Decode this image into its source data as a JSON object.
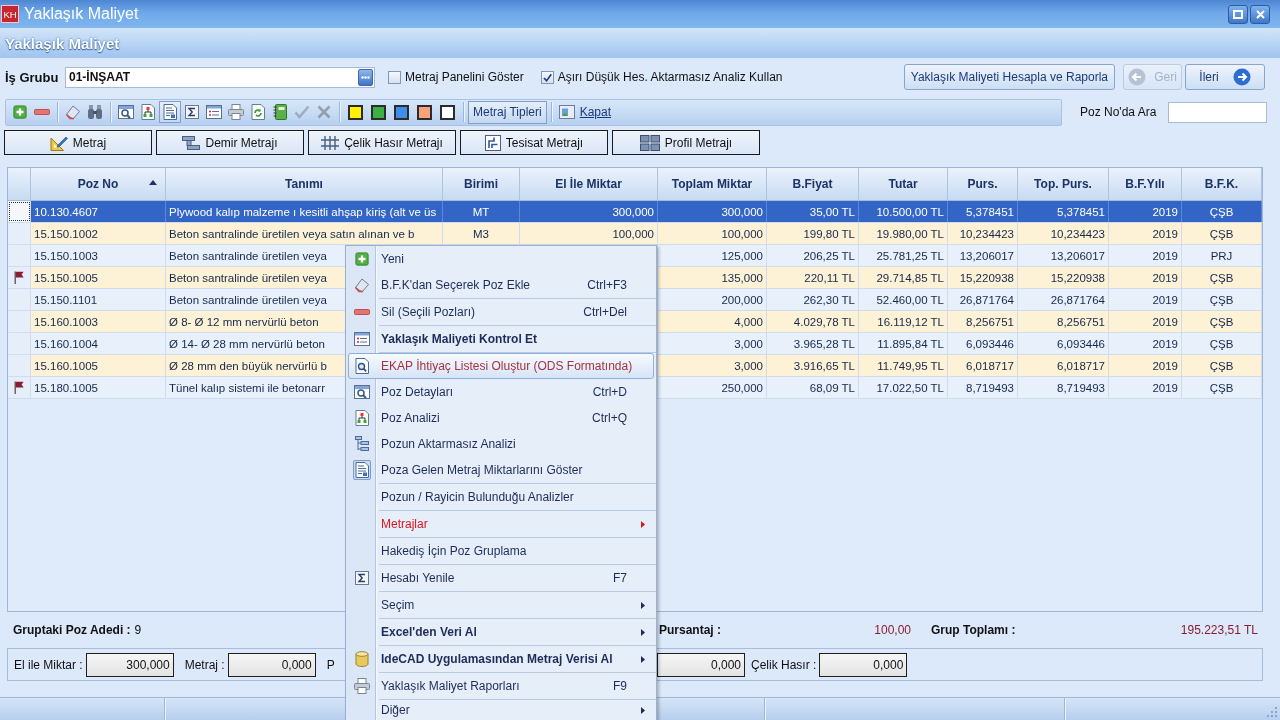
{
  "window": {
    "logo": "KH",
    "title": "Yaklaşık Maliyet"
  },
  "header": {
    "title": "Yaklaşık Maliyet"
  },
  "work_group": {
    "label": "İş Grubu",
    "value": "01-İNŞAAT"
  },
  "options": [
    {
      "label": "Metraj Panelini Göster",
      "checked": false
    },
    {
      "label": "Aşırı Düşük Hes. Aktarmasız Analiz Kullan",
      "checked": true
    }
  ],
  "actions": [
    {
      "kind": "plain",
      "label": "Yaklaşık Maliyeti Hesapla ve Raporla",
      "disabled": false
    },
    {
      "kind": "back",
      "label": "Geri",
      "disabled": true
    },
    {
      "kind": "forward",
      "label": "İleri",
      "disabled": false
    }
  ],
  "toolbar": [
    [
      {
        "kind": "icon",
        "pressed": false,
        "disabled": false
      },
      {
        "kind": "icon",
        "pressed": false,
        "disabled": false
      }
    ],
    [
      {
        "kind": "icon",
        "pressed": false,
        "disabled": false
      },
      {
        "kind": "icon",
        "pressed": false,
        "disabled": false
      }
    ],
    [
      {
        "kind": "icon",
        "pressed": false,
        "disabled": false
      },
      {
        "kind": "icon",
        "pressed": false,
        "disabled": false
      },
      {
        "kind": "icon",
        "pressed": true,
        "disabled": false
      },
      {
        "kind": "icon",
        "pressed": false,
        "disabled": false
      },
      {
        "kind": "icon",
        "pressed": false,
        "disabled": false
      },
      {
        "kind": "icon",
        "pressed": false,
        "disabled": false
      },
      {
        "kind": "icon",
        "pressed": false,
        "disabled": false
      },
      {
        "kind": "icon",
        "pressed": false,
        "disabled": false
      },
      {
        "kind": "icon",
        "pressed": false,
        "disabled": true
      },
      {
        "kind": "icon",
        "pressed": false,
        "disabled": true
      }
    ],
    [
      {
        "kind": "swatch",
        "color": "#fff200"
      },
      {
        "kind": "swatch",
        "color": "#3cb043"
      },
      {
        "kind": "swatch",
        "color": "#3d8ee8"
      },
      {
        "kind": "swatch",
        "color": "#f7a27a"
      },
      {
        "kind": "swatch",
        "color": "#ffffff"
      }
    ],
    [
      {
        "kind": "toggle",
        "label": "Metraj Tipleri",
        "pressed": true
      }
    ],
    [
      {
        "kind": "link",
        "label": "Kapat"
      }
    ]
  ],
  "search": {
    "label": "Poz No'da Ara"
  },
  "metraj_buttons": [
    "Metraj",
    "Demir Metrajı",
    "Çelik Hasır Metrajı",
    "Tesisat Metrajı",
    "Profil Metrajı"
  ],
  "table": {
    "columns": [
      {
        "label": "Poz No",
        "sorted": true
      },
      {
        "label": "Tanımı",
        "sorted": false
      },
      {
        "label": "Birimi",
        "sorted": false
      },
      {
        "label": "El İle Miktar",
        "sorted": false
      },
      {
        "label": "Toplam Miktar",
        "sorted": false
      },
      {
        "label": "B.Fiyat",
        "sorted": false
      },
      {
        "label": "Tutar",
        "sorted": false
      },
      {
        "label": "Purs.",
        "sorted": false
      },
      {
        "label": "Top. Purs.",
        "sorted": false
      },
      {
        "label": "B.F.Yılı",
        "sorted": false
      },
      {
        "label": "B.F.K.",
        "sorted": false
      }
    ],
    "rows": [
      {
        "flagged": false,
        "selected": true,
        "cells": [
          "10.130.4607",
          "Plywood kalıp malzeme ı kesitli ahşap kiriş (alt ve üs",
          "MT",
          "300,000",
          "300,000",
          "35,00 TL",
          "10.500,00 TL",
          "5,378451",
          "5,378451",
          "2019",
          "ÇŞB"
        ]
      },
      {
        "flagged": false,
        "selected": false,
        "cells": [
          "15.150.1002",
          "Beton santralinde üretilen veya satın alınan ve b",
          "M3",
          "100,000",
          "100,000",
          "199,80 TL",
          "19.980,00 TL",
          "10,234423",
          "10,234423",
          "2019",
          "ÇŞB"
        ]
      },
      {
        "flagged": false,
        "selected": false,
        "cells": [
          "15.150.1003",
          "Beton santralinde üretilen veya",
          null,
          null,
          "125,000",
          "206,25 TL",
          "25.781,25 TL",
          "13,206017",
          "13,206017",
          "2019",
          "PRJ"
        ]
      },
      {
        "flagged": true,
        "selected": false,
        "cells": [
          "15.150.1005",
          "Beton santralinde üretilen veya",
          null,
          null,
          "135,000",
          "220,11 TL",
          "29.714,85 TL",
          "15,220938",
          "15,220938",
          "2019",
          "ÇŞB"
        ]
      },
      {
        "flagged": false,
        "selected": false,
        "cells": [
          "15.150.1101",
          "Beton santralinde üretilen veya",
          null,
          null,
          "200,000",
          "262,30 TL",
          "52.460,00 TL",
          "26,871764",
          "26,871764",
          "2019",
          "ÇŞB"
        ]
      },
      {
        "flagged": false,
        "selected": false,
        "cells": [
          "15.160.1003",
          "Ø 8- Ø 12 mm nervürlü beton",
          null,
          null,
          "4,000",
          "4.029,78 TL",
          "16.119,12 TL",
          "8,256751",
          "8,256751",
          "2019",
          "ÇŞB"
        ]
      },
      {
        "flagged": false,
        "selected": false,
        "cells": [
          "15.160.1004",
          "Ø 14- Ø 28 mm nervürlü beton",
          null,
          null,
          "3,000",
          "3.965,28 TL",
          "11.895,84 TL",
          "6,093446",
          "6,093446",
          "2019",
          "ÇŞB"
        ]
      },
      {
        "flagged": false,
        "selected": false,
        "cells": [
          "15.160.1005",
          "Ø 28 mm den büyük nervürlü b",
          null,
          null,
          "3,000",
          "3.916,65 TL",
          "11.749,95 TL",
          "6,018717",
          "6,018717",
          "2019",
          "ÇŞB"
        ]
      },
      {
        "flagged": true,
        "selected": false,
        "cells": [
          "15.180.1005",
          "Tünel kalıp sistemi ile betonarr",
          null,
          null,
          "250,000",
          "68,09 TL",
          "17.022,50 TL",
          "8,719493",
          "8,719493",
          "2019",
          "ÇŞB"
        ]
      }
    ]
  },
  "summary": [
    {
      "kind": "count",
      "label": "Gruptaki Poz Adedi :",
      "value": "9"
    },
    {
      "kind": "amount",
      "label": "Pursantaj :",
      "value": "100,00"
    },
    {
      "kind": "amount",
      "label": "Grup Toplamı :",
      "value": "195.223,51 TL"
    }
  ],
  "quantities": [
    [
      {
        "label": "El ile Miktar :",
        "value": "300,000"
      },
      {
        "label": "Metraj :",
        "value": "0,000"
      },
      {
        "label": "P"
      }
    ],
    [
      {
        "value": "0,000"
      },
      {
        "label": "Çelik Hasır :",
        "value": "0,000"
      }
    ]
  ],
  "context_menu": [
    [
      {
        "label": "Yeni",
        "kind": "normal",
        "submenu": false,
        "selected": false,
        "checked": false
      },
      {
        "label": "B.F.K'dan Seçerek Poz Ekle",
        "shortcut": "Ctrl+F3",
        "kind": "normal",
        "submenu": false,
        "selected": false,
        "checked": false
      }
    ],
    [
      {
        "label": "Sil (Seçili Pozları)",
        "shortcut": "Ctrl+Del",
        "kind": "normal",
        "submenu": false,
        "selected": false,
        "checked": false
      }
    ],
    [
      {
        "label": "Yaklaşık Maliyeti Kontrol Et",
        "kind": "bold",
        "submenu": false,
        "selected": false,
        "checked": false
      }
    ],
    [
      {
        "label": "EKAP İhtiyaç Listesi Oluştur (ODS Formatında)",
        "kind": "normal",
        "submenu": false,
        "selected": true,
        "checked": false
      },
      {
        "label": "Poz Detayları",
        "shortcut": "Ctrl+D",
        "kind": "normal",
        "submenu": false,
        "selected": false,
        "checked": false
      },
      {
        "label": "Poz Analizi",
        "shortcut": "Ctrl+Q",
        "kind": "normal",
        "submenu": false,
        "selected": false,
        "checked": false
      },
      {
        "label": "Pozun Aktarmasız Analizi",
        "kind": "normal",
        "submenu": false,
        "selected": false,
        "checked": false
      },
      {
        "label": "Poza Gelen Metraj Miktarlarını Göster",
        "kind": "normal",
        "submenu": false,
        "selected": false,
        "checked": true
      }
    ],
    [
      {
        "label": "Pozun / Rayicin Bulunduğu Analizler",
        "kind": "normal",
        "submenu": false,
        "selected": false,
        "checked": false
      }
    ],
    [
      {
        "label": "Metrajlar",
        "kind": "alert",
        "submenu": true,
        "selected": false,
        "checked": false
      }
    ],
    [
      {
        "label": "Hakediş İçin Poz Gruplama",
        "kind": "normal",
        "submenu": false,
        "selected": false,
        "checked": false
      }
    ],
    [
      {
        "label": "Hesabı Yenile",
        "shortcut": "F7",
        "kind": "normal",
        "submenu": false,
        "selected": false,
        "checked": false
      }
    ],
    [
      {
        "label": "Seçim",
        "kind": "normal",
        "submenu": true,
        "selected": false,
        "checked": false
      }
    ],
    [
      {
        "label": "Excel'den Veri Al",
        "kind": "bold",
        "submenu": true,
        "selected": false,
        "checked": false
      }
    ],
    [
      {
        "label": "IdeCAD Uygulamasından Metraj Verisi Al",
        "kind": "bold",
        "submenu": true,
        "selected": false,
        "checked": false
      }
    ],
    [
      {
        "label": "Yaklaşık Maliyet Raporları",
        "shortcut": "F9",
        "kind": "normal",
        "submenu": false,
        "selected": false,
        "checked": false
      }
    ],
    [
      {
        "label": "Diğer",
        "kind": "normal",
        "submenu": true,
        "selected": false,
        "checked": false
      }
    ]
  ]
}
